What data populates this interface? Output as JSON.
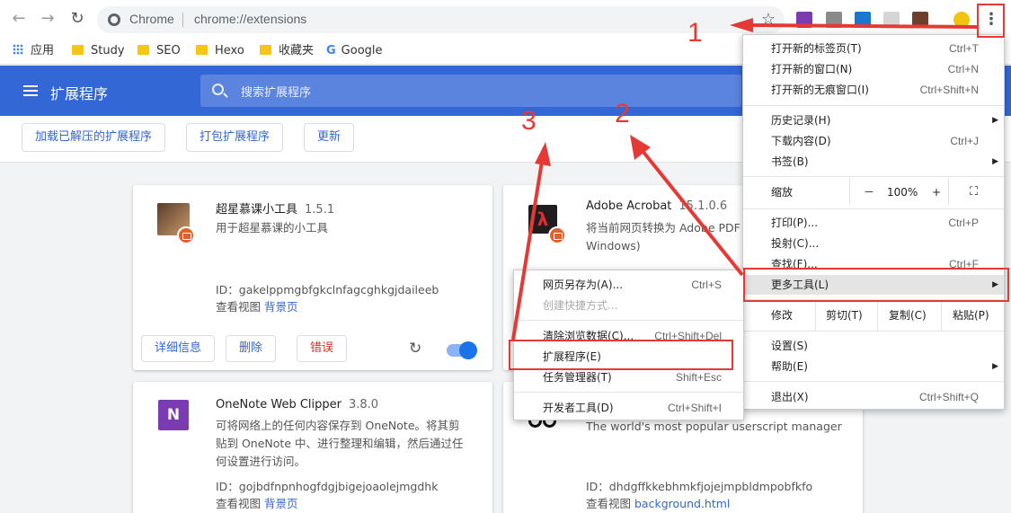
{
  "browser": {
    "site_name": "Chrome",
    "url": "chrome://extensions"
  },
  "bookmarks": [
    {
      "label": "应用",
      "icon": "apps-icon"
    },
    {
      "label": "Study",
      "icon": "folder-icon"
    },
    {
      "label": "SEO",
      "icon": "folder-icon"
    },
    {
      "label": "Hexo",
      "icon": "folder-icon"
    },
    {
      "label": "收藏夹",
      "icon": "folder-icon"
    },
    {
      "label": "Google",
      "icon": "google-icon"
    }
  ],
  "header": {
    "title": "扩展程序",
    "search_placeholder": "搜索扩展程序"
  },
  "actions": {
    "load_unpacked": "加载已解压的扩展程序",
    "pack": "打包扩展程序",
    "update": "更新"
  },
  "extensions": [
    {
      "name": "超星慕课小工具",
      "version": "1.5.1",
      "desc": "用于超星慕课的小工具",
      "id": "ID：gakelppmgbfgkclnfagcghkgjdaileeb",
      "views_label": "查看视图",
      "views_link": "背景页",
      "details_btn": "详细信息",
      "remove_btn": "删除",
      "errors_btn": "错误"
    },
    {
      "name": "Adobe Acrobat",
      "version": "15.1.0.6",
      "desc_line1": "将当前网页转换为 Adobe PDF",
      "desc_line2": "Windows)"
    },
    {
      "name": "OneNote Web Clipper",
      "version": "3.8.0",
      "desc_line1": "可将网络上的任何内容保存到 OneNote。将其剪",
      "desc_line2": "贴到 OneNote 中、进行整理和编辑，然后通过任",
      "desc_line3": "何设置进行访问。",
      "id": "ID：gojbdfnpnhogfdgjbigejoaolejmgdhk",
      "views_label": "查看视图",
      "views_link": "背景页"
    },
    {
      "desc": "The world's most popular userscript manager",
      "id": "ID：dhdgffkkebhmkfjojejmpbldmpobfkfo",
      "views_label": "查看视图",
      "views_link": "background.html"
    }
  ],
  "menu": {
    "new_tab": {
      "label": "打开新的标签页(T)",
      "shortcut": "Ctrl+T"
    },
    "new_window": {
      "label": "打开新的窗口(N)",
      "shortcut": "Ctrl+N"
    },
    "incognito": {
      "label": "打开新的无痕窗口(I)",
      "shortcut": "Ctrl+Shift+N"
    },
    "history": {
      "label": "历史记录(H)"
    },
    "downloads": {
      "label": "下载内容(D)",
      "shortcut": "Ctrl+J"
    },
    "bookmarks": {
      "label": "书签(B)"
    },
    "zoom": {
      "label": "缩放",
      "minus": "－",
      "value": "100%",
      "plus": "+"
    },
    "print": {
      "label": "打印(P)...",
      "shortcut": "Ctrl+P"
    },
    "cast": {
      "label": "投射(C)..."
    },
    "find": {
      "label": "查找(F)...",
      "shortcut": "Ctrl+F"
    },
    "more_tools": {
      "label": "更多工具(L)"
    },
    "edit": {
      "label": "修改",
      "cut": "剪切(T)",
      "copy": "复制(C)",
      "paste": "粘贴(P)"
    },
    "settings": {
      "label": "设置(S)"
    },
    "help": {
      "label": "帮助(E)"
    },
    "exit": {
      "label": "退出(X)",
      "shortcut": "Ctrl+Shift+Q"
    }
  },
  "submenu": {
    "save_as": {
      "label": "网页另存为(A)...",
      "shortcut": "Ctrl+S"
    },
    "shortcut": {
      "label": "创建快捷方式..."
    },
    "clear": {
      "label": "清除浏览数据(C)...",
      "shortcut": "Ctrl+Shift+Del"
    },
    "extensions": {
      "label": "扩展程序(E)"
    },
    "task_manager": {
      "label": "任务管理器(T)",
      "shortcut": "Shift+Esc"
    },
    "devtools": {
      "label": "开发者工具(D)",
      "shortcut": "Ctrl+Shift+I"
    }
  },
  "annotations": {
    "step1": "1",
    "step2": "2",
    "step3": "3"
  },
  "colors": {
    "accent": "#3367d6",
    "annotation": "#e53935"
  }
}
